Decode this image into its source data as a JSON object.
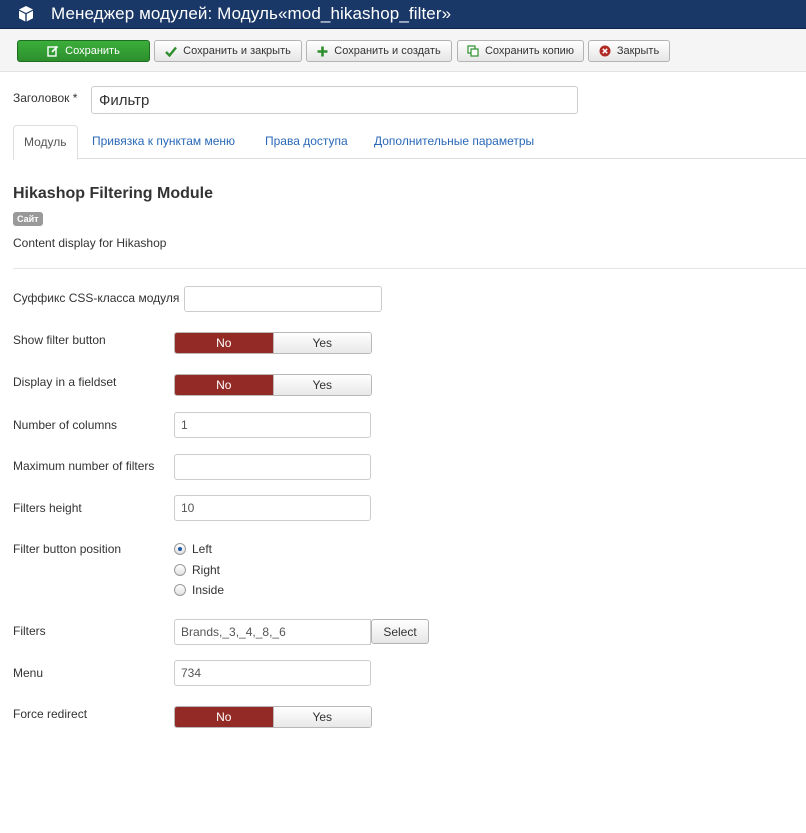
{
  "header": {
    "title": "Менеджер модулей: Модуль«mod_hikashop_filter»",
    "logo_icon": "cube-icon"
  },
  "toolbar": {
    "save_label": "Сохранить",
    "save_close_label": "Сохранить и закрыть",
    "save_new_label": "Сохранить и создать",
    "save_copy_label": "Сохранить копию",
    "close_label": "Закрыть"
  },
  "title_field": {
    "label": "Заголовок *",
    "value": "Фильтр"
  },
  "tabs": [
    {
      "label": "Модуль",
      "active": true
    },
    {
      "label": "Привязка к пунктам меню",
      "active": false
    },
    {
      "label": "Права доступа",
      "active": false
    },
    {
      "label": "Дополнительные параметры",
      "active": false
    }
  ],
  "module": {
    "name": "Hikashop Filtering Module",
    "badge": "Сайт",
    "description": "Content display for Hikashop"
  },
  "fields": {
    "css_suffix": {
      "label": "Суффикс CSS-класса модуля",
      "value": ""
    },
    "show_filter_button": {
      "label": "Show filter button",
      "no": "No",
      "yes": "Yes",
      "selected": "No"
    },
    "display_fieldset": {
      "label": "Display in a fieldset",
      "no": "No",
      "yes": "Yes",
      "selected": "No"
    },
    "num_columns": {
      "label": "Number of columns",
      "value": "1"
    },
    "max_filters": {
      "label": "Maximum number of filters",
      "value": ""
    },
    "filters_height": {
      "label": "Filters height",
      "value": "10"
    },
    "filter_button_position": {
      "label": "Filter button position",
      "options": [
        "Left",
        "Right",
        "Inside"
      ],
      "selected": "Left"
    },
    "filters": {
      "label": "Filters",
      "value": "Brands,_3,_4,_8,_6",
      "select_label": "Select"
    },
    "menu": {
      "label": "Menu",
      "value": "734"
    },
    "force_redirect": {
      "label": "Force redirect",
      "no": "No",
      "yes": "Yes",
      "selected": "No"
    }
  },
  "colors": {
    "header_bg": "#1a3867",
    "success": "#2d8f2d",
    "toggle_no_active": "#942a25",
    "link": "#2a69b8"
  }
}
